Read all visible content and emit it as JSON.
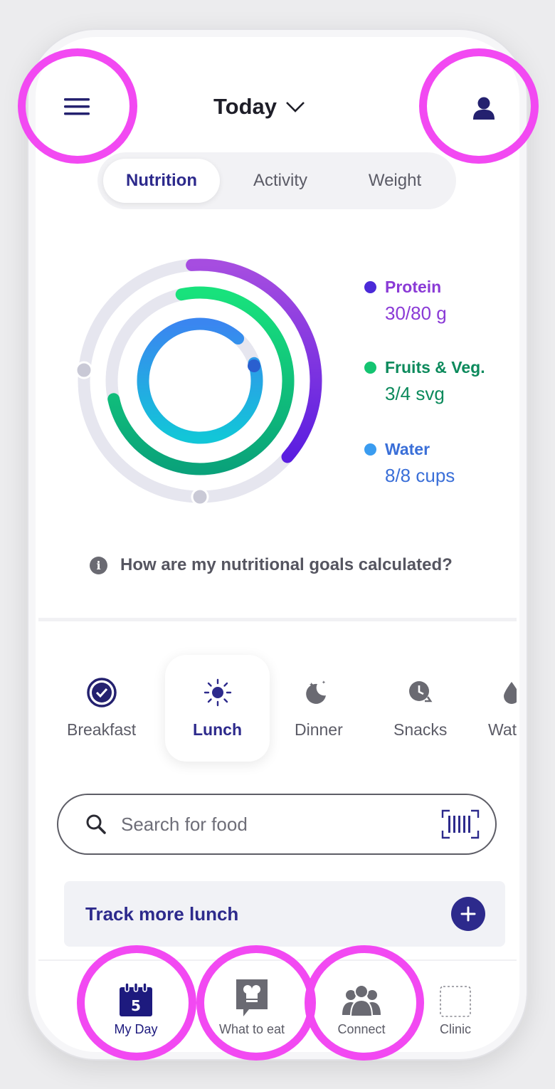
{
  "header": {
    "title": "Today"
  },
  "tabs": [
    {
      "label": "Nutrition",
      "active": true
    },
    {
      "label": "Activity",
      "active": false
    },
    {
      "label": "Weight",
      "active": false
    }
  ],
  "nutrition": [
    {
      "name": "Protein",
      "value": "30/80 g",
      "progress": 0.375,
      "color": "#7b3fe0"
    },
    {
      "name": "Fruits & Veg.",
      "value": "3/4 svg",
      "progress": 0.75,
      "color": "#1fbf6a"
    },
    {
      "name": "Water",
      "value": "8/8 cups",
      "progress": 1.0,
      "color": "#2f7fe0"
    }
  ],
  "info_text": "How are my nutritional goals calculated?",
  "meals": [
    {
      "label": "Breakfast",
      "icon": "check-circle-icon",
      "selected": false
    },
    {
      "label": "Lunch",
      "icon": "sun-icon",
      "selected": true
    },
    {
      "label": "Dinner",
      "icon": "moon-icon",
      "selected": false
    },
    {
      "label": "Snacks",
      "icon": "clock-icon",
      "selected": false
    },
    {
      "label": "Wat",
      "icon": "water-drop-icon",
      "selected": false
    }
  ],
  "search": {
    "placeholder": "Search for food"
  },
  "track": {
    "label": "Track more lunch"
  },
  "nav": [
    {
      "label": "My Day",
      "icon": "calendar-icon",
      "calendar_day": "5",
      "active": true
    },
    {
      "label": "What to eat",
      "icon": "chef-book-icon",
      "active": false
    },
    {
      "label": "Connect",
      "icon": "people-icon",
      "active": false
    },
    {
      "label": "Clinic",
      "icon": "clinic-placeholder-icon",
      "active": false
    }
  ],
  "colors": {
    "brand": "#2d2a8c",
    "highlight_ring": "#f249f2",
    "protein": "#7b3fe0",
    "fruits_veg": "#0fa56a",
    "water": "#3a6fd8"
  }
}
